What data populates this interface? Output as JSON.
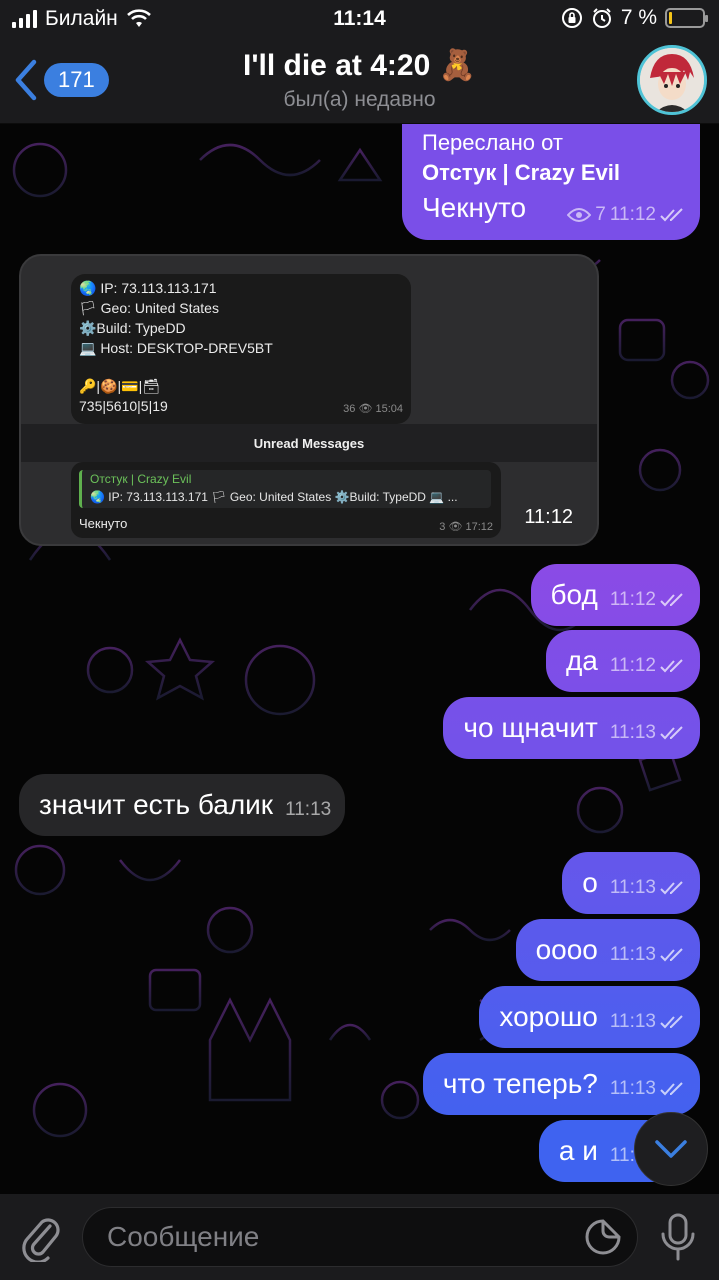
{
  "status_bar": {
    "carrier": "Билайн",
    "time": "11:14",
    "battery_text": "7 %",
    "battery_level": 0.07
  },
  "header": {
    "back_count": "171",
    "title": "I'll die at 4:20 🧸",
    "subtitle": "был(а) недавно"
  },
  "forwarded": {
    "label": "Переслано от",
    "from": "Отстук | Crazy Evil",
    "text": "Чекнуто",
    "views": "7",
    "time": "11:12"
  },
  "image_message": {
    "time": "11:12",
    "screenshot": {
      "lines": [
        "🌏 IP: 73.113.113.171",
        "🏳 Geo: United States",
        "⚙️Build: TypeDD",
        "💻 Host: DESKTOP-DREV5BT",
        "🔑|🍪|💳|🗃",
        "735|5610|5|19"
      ],
      "card1_meta": "36 👁 15:04",
      "unread": "Unread Messages",
      "quote_name": "Отстук | Crazy Evil",
      "quote_text": "🌏 IP: 73.113.113.171 🏳 Geo: United States ⚙️Build: TypeDD 💻 ...",
      "card2_text": "Чекнуто",
      "card2_meta": "3 👁 17:12"
    }
  },
  "messages": [
    {
      "text": "бод",
      "time": "11:12",
      "dir": "out"
    },
    {
      "text": "да",
      "time": "11:12",
      "dir": "out"
    },
    {
      "text": "чо щначит",
      "time": "11:13",
      "dir": "out"
    },
    {
      "text": "значит есть балик",
      "time": "11:13",
      "dir": "in"
    },
    {
      "text": "о",
      "time": "11:13",
      "dir": "out"
    },
    {
      "text": "оооо",
      "time": "11:13",
      "dir": "out"
    },
    {
      "text": "хорошо",
      "time": "11:13",
      "dir": "out"
    },
    {
      "text": "что теперь?",
      "time": "11:13",
      "dir": "out"
    },
    {
      "text": "а и",
      "time": "11:13",
      "dir": "out"
    }
  ],
  "composer": {
    "placeholder": "Сообщение"
  },
  "colors": {
    "out_bubble_top": "#8a4be6",
    "out_bubble_bottom": "#3f63f0",
    "in_bubble": "#262628",
    "bar": "#1b1b1d",
    "accent": "#3b7fe0"
  }
}
